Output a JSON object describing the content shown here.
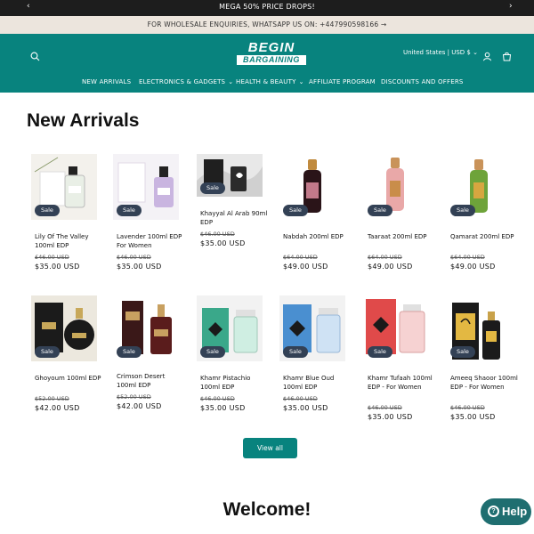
{
  "announcement": {
    "text": "MEGA 50% PRICE DROPS!",
    "prev_icon": "chevron-left-icon",
    "next_icon": "chevron-right-icon"
  },
  "wholesale": {
    "text": "FOR WHOLESALE ENQUIRIES, WHATSAPP US ON: +447990598166 →"
  },
  "header": {
    "logo_line1": "BEGIN",
    "logo_line2": "BARGAINING",
    "locale": "United States | USD $ ⌄",
    "icons": [
      "search-icon",
      "account-icon",
      "cart-icon"
    ]
  },
  "nav": [
    {
      "label": "NEW ARRIVALS",
      "dropdown": false
    },
    {
      "label": "ELECTRONICS & GADGETS",
      "dropdown": true
    },
    {
      "label": "HEALTH & BEAUTY",
      "dropdown": true
    },
    {
      "label": "AFFILIATE PROGRAM",
      "dropdown": false
    },
    {
      "label": "DISCOUNTS AND OFFERS",
      "dropdown": false
    }
  ],
  "section": {
    "title": "New Arrivals"
  },
  "products": [
    {
      "name": "Lily Of The Valley 100ml EDP",
      "old_price": "£46.00 USD",
      "price": "$35.00 USD",
      "badge": "Sale"
    },
    {
      "name": "Lavender 100ml EDP For Women",
      "old_price": "$46.00 USD",
      "price": "$35.00 USD",
      "badge": "Sale"
    },
    {
      "name": "Khayyal Al Arab 90ml EDP",
      "old_price": "$46.00 USD",
      "price": "$35.00 USD",
      "badge": "Sale"
    },
    {
      "name": "Nabdah 200ml EDP",
      "old_price": "$64.00 USD",
      "price": "$49.00 USD",
      "badge": "Sale"
    },
    {
      "name": "Taaraat 200ml EDP",
      "old_price": "$64.00 USD",
      "price": "$49.00 USD",
      "badge": "Sale"
    },
    {
      "name": "Qamarat 200ml EDP",
      "old_price": "$64.00 USD",
      "price": "$49.00 USD",
      "badge": "Sale"
    },
    {
      "name": "Ghoyoum 100ml EDP",
      "old_price": "$52.00 USD",
      "price": "$42.00 USD",
      "badge": "Sale"
    },
    {
      "name": "Crimson Desert 100ml EDP",
      "old_price": "$52.00 USD",
      "price": "$42.00 USD",
      "badge": "Sale"
    },
    {
      "name": "Khamr Pistachio 100ml EDP",
      "old_price": "$46.00 USD",
      "price": "$35.00 USD",
      "badge": "Sale"
    },
    {
      "name": "Khamr Blue Oud 100ml EDP",
      "old_price": "$46.00 USD",
      "price": "$35.00 USD",
      "badge": "Sale"
    },
    {
      "name": "Khamr Tufaah 100ml EDP - For Women",
      "old_price": "$46.00 USD",
      "price": "$35.00 USD",
      "badge": "Sale"
    },
    {
      "name": "Ameeq Shaoor 100ml EDP - For Women",
      "old_price": "$46.00 USD",
      "price": "$35.00 USD",
      "badge": "Sale"
    }
  ],
  "view_all": "View all",
  "welcome": "Welcome!",
  "help": "Help",
  "colors": {
    "brand": "#08837e",
    "badge": "#334155",
    "announce_bg": "#1d1d1d",
    "wholesale_bg": "#ece5dd"
  }
}
